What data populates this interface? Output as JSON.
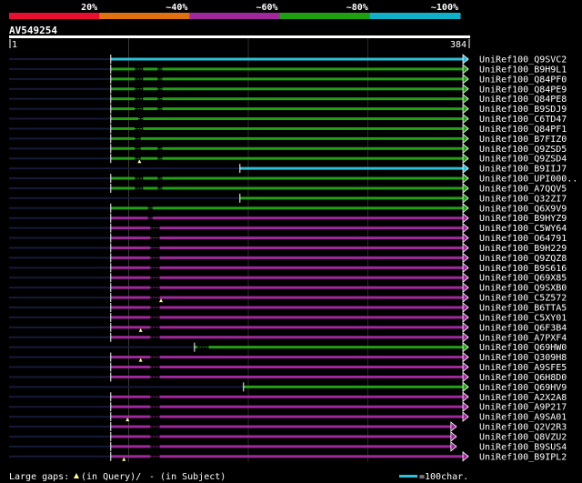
{
  "legend": {
    "labels": [
      "20%",
      "~40%",
      "~60%",
      "~80%",
      "~100%"
    ],
    "colors": [
      "#e8102e",
      "#e07010",
      "#a0289c",
      "#1fa010",
      "#10b0c8"
    ]
  },
  "query": {
    "id": "AV549254",
    "start": "1",
    "end": "384",
    "length": 384
  },
  "colors": {
    "background": "#000000",
    "query_line": "#151a3a",
    "guide": "#2c2c2c",
    "insert_marker": "#ffff90",
    "cyan": "#2cc0d8",
    "green": "#23a016",
    "purple": "#a0289c",
    "text": "#ffffff"
  },
  "hits": [
    {
      "label": "UniRef100_Q9SVC2",
      "color": "cyan",
      "start": 85,
      "end": 384,
      "arrow": true,
      "gaps": [],
      "ins": []
    },
    {
      "label": "UniRef100_B9H9L1",
      "color": "green",
      "start": 85,
      "end": 384,
      "arrow": true,
      "gaps": [
        [
          105,
          112
        ],
        [
          124,
          128
        ]
      ],
      "ins": []
    },
    {
      "label": "UniRef100_Q84PF0",
      "color": "green",
      "start": 85,
      "end": 384,
      "arrow": true,
      "gaps": [
        [
          105,
          112
        ],
        [
          124,
          128
        ]
      ],
      "ins": []
    },
    {
      "label": "UniRef100_Q84PE9",
      "color": "green",
      "start": 85,
      "end": 384,
      "arrow": true,
      "gaps": [
        [
          105,
          112
        ],
        [
          124,
          128
        ]
      ],
      "ins": []
    },
    {
      "label": "UniRef100_Q84PE8",
      "color": "green",
      "start": 85,
      "end": 384,
      "arrow": true,
      "gaps": [
        [
          105,
          112
        ],
        [
          124,
          128
        ]
      ],
      "ins": []
    },
    {
      "label": "UniRef100_B9SDJ9",
      "color": "green",
      "start": 85,
      "end": 384,
      "arrow": true,
      "gaps": [
        [
          105,
          112
        ],
        [
          124,
          128
        ]
      ],
      "ins": []
    },
    {
      "label": "UniRef100_C6TD47",
      "color": "green",
      "start": 85,
      "end": 384,
      "arrow": true,
      "gaps": [
        [
          108,
          112
        ]
      ],
      "ins": []
    },
    {
      "label": "UniRef100_Q84PF1",
      "color": "green",
      "start": 85,
      "end": 384,
      "arrow": true,
      "gaps": [
        [
          105,
          112
        ]
      ],
      "ins": []
    },
    {
      "label": "UniRef100_B7FIZ0",
      "color": "green",
      "start": 85,
      "end": 384,
      "arrow": true,
      "gaps": [
        [
          105,
          110
        ]
      ],
      "ins": []
    },
    {
      "label": "UniRef100_Q9ZSD5",
      "color": "green",
      "start": 85,
      "end": 384,
      "arrow": true,
      "gaps": [
        [
          105,
          110
        ],
        [
          124,
          128
        ]
      ],
      "ins": []
    },
    {
      "label": "UniRef100_Q9ZSD4",
      "color": "green",
      "start": 85,
      "end": 384,
      "arrow": true,
      "gaps": [
        [
          105,
          110
        ],
        [
          124,
          128
        ]
      ],
      "ins": [
        109
      ]
    },
    {
      "label": "UniRef100_B9IIJ7",
      "color": "cyan",
      "start": 193,
      "end": 384,
      "arrow": true,
      "gaps": [],
      "ins": []
    },
    {
      "label": "UniRef100_UPI000..",
      "color": "green",
      "start": 85,
      "end": 384,
      "arrow": true,
      "gaps": [
        [
          105,
          112
        ],
        [
          124,
          128
        ]
      ],
      "ins": []
    },
    {
      "label": "UniRef100_A7QQV5",
      "color": "green",
      "start": 85,
      "end": 384,
      "arrow": true,
      "gaps": [
        [
          105,
          112
        ],
        [
          124,
          128
        ]
      ],
      "ins": []
    },
    {
      "label": "UniRef100_Q32ZI7",
      "color": "green",
      "start": 193,
      "end": 384,
      "arrow": true,
      "gaps": [],
      "ins": []
    },
    {
      "label": "UniRef100_Q6X9V9",
      "color": "green",
      "start": 85,
      "end": 384,
      "arrow": true,
      "gaps": [
        [
          116,
          120
        ]
      ],
      "ins": []
    },
    {
      "label": "UniRef100_B9HYZ9",
      "color": "purple",
      "start": 85,
      "end": 384,
      "arrow": true,
      "gaps": [
        [
          116,
          120
        ]
      ],
      "ins": []
    },
    {
      "label": "UniRef100_C5WY64",
      "color": "purple",
      "start": 85,
      "end": 384,
      "arrow": true,
      "gaps": [
        [
          118,
          126
        ]
      ],
      "ins": []
    },
    {
      "label": "UniRef100_O64791",
      "color": "purple",
      "start": 85,
      "end": 384,
      "arrow": true,
      "gaps": [
        [
          118,
          126
        ]
      ],
      "ins": []
    },
    {
      "label": "UniRef100_B9H229",
      "color": "purple",
      "start": 85,
      "end": 384,
      "arrow": true,
      "gaps": [
        [
          118,
          126
        ]
      ],
      "ins": []
    },
    {
      "label": "UniRef100_Q9ZQZ8",
      "color": "purple",
      "start": 85,
      "end": 384,
      "arrow": true,
      "gaps": [
        [
          118,
          126
        ]
      ],
      "ins": []
    },
    {
      "label": "UniRef100_B9S616",
      "color": "purple",
      "start": 85,
      "end": 384,
      "arrow": true,
      "gaps": [
        [
          118,
          126
        ]
      ],
      "ins": []
    },
    {
      "label": "UniRef100_Q69X85",
      "color": "purple",
      "start": 85,
      "end": 384,
      "arrow": true,
      "gaps": [
        [
          118,
          126
        ]
      ],
      "ins": []
    },
    {
      "label": "UniRef100_Q9SXB0",
      "color": "purple",
      "start": 85,
      "end": 384,
      "arrow": true,
      "gaps": [
        [
          118,
          126
        ]
      ],
      "ins": []
    },
    {
      "label": "UniRef100_C5Z572",
      "color": "purple",
      "start": 85,
      "end": 384,
      "arrow": true,
      "gaps": [
        [
          118,
          126
        ]
      ],
      "ins": [
        127
      ]
    },
    {
      "label": "UniRef100_B6TTA5",
      "color": "purple",
      "start": 85,
      "end": 384,
      "arrow": true,
      "gaps": [
        [
          118,
          126
        ]
      ],
      "ins": []
    },
    {
      "label": "UniRef100_C5XY01",
      "color": "purple",
      "start": 85,
      "end": 384,
      "arrow": true,
      "gaps": [
        [
          118,
          126
        ]
      ],
      "ins": []
    },
    {
      "label": "UniRef100_Q6F3B4",
      "color": "purple",
      "start": 85,
      "end": 384,
      "arrow": true,
      "gaps": [
        [
          118,
          126
        ]
      ],
      "ins": [
        110
      ]
    },
    {
      "label": "UniRef100_A7PXF4",
      "color": "purple",
      "start": 85,
      "end": 384,
      "arrow": true,
      "gaps": [
        [
          118,
          126
        ]
      ],
      "ins": []
    },
    {
      "label": "UniRef100_Q69HW0",
      "color": "green",
      "start": 155,
      "end": 384,
      "arrow": true,
      "gaps": [
        [
          157,
          167
        ]
      ],
      "ins": []
    },
    {
      "label": "UniRef100_Q309H8",
      "color": "purple",
      "start": 85,
      "end": 384,
      "arrow": true,
      "gaps": [
        [
          118,
          126
        ]
      ],
      "ins": [
        110
      ]
    },
    {
      "label": "UniRef100_A9SFE5",
      "color": "purple",
      "start": 85,
      "end": 384,
      "arrow": true,
      "gaps": [
        [
          118,
          126
        ]
      ],
      "ins": []
    },
    {
      "label": "UniRef100_Q6H8D0",
      "color": "purple",
      "start": 85,
      "end": 384,
      "arrow": true,
      "gaps": [
        [
          118,
          126
        ]
      ],
      "ins": []
    },
    {
      "label": "UniRef100_Q69HV9",
      "color": "green",
      "start": 196,
      "end": 384,
      "arrow": true,
      "gaps": [],
      "ins": []
    },
    {
      "label": "UniRef100_A2X2A8",
      "color": "purple",
      "start": 85,
      "end": 384,
      "arrow": true,
      "gaps": [
        [
          118,
          126
        ]
      ],
      "ins": []
    },
    {
      "label": "UniRef100_A9P217",
      "color": "purple",
      "start": 85,
      "end": 384,
      "arrow": true,
      "gaps": [
        [
          118,
          126
        ]
      ],
      "ins": []
    },
    {
      "label": "UniRef100_A9SA01",
      "color": "purple",
      "start": 85,
      "end": 384,
      "arrow": true,
      "gaps": [
        [
          118,
          126
        ]
      ],
      "ins": [
        99
      ]
    },
    {
      "label": "UniRef100_Q2V2R3",
      "color": "purple",
      "start": 85,
      "end": 374,
      "arrow": true,
      "gaps": [
        [
          118,
          126
        ]
      ],
      "ins": []
    },
    {
      "label": "UniRef100_Q8VZU2",
      "color": "purple",
      "start": 85,
      "end": 374,
      "arrow": true,
      "gaps": [
        [
          118,
          126
        ]
      ],
      "ins": []
    },
    {
      "label": "UniRef100_B9SUS4",
      "color": "purple",
      "start": 85,
      "end": 374,
      "arrow": true,
      "gaps": [
        [
          118,
          126
        ]
      ],
      "ins": []
    },
    {
      "label": "UniRef100_B9IPL2",
      "color": "purple",
      "start": 85,
      "end": 384,
      "arrow": true,
      "gaps": [
        [
          118,
          126
        ]
      ],
      "ins": [
        96
      ]
    }
  ],
  "footer": {
    "gaps_label": "Large gaps:",
    "gaps_query": "(in Query)/",
    "gaps_subject": "- (in Subject)",
    "scale_label": "=100char."
  }
}
